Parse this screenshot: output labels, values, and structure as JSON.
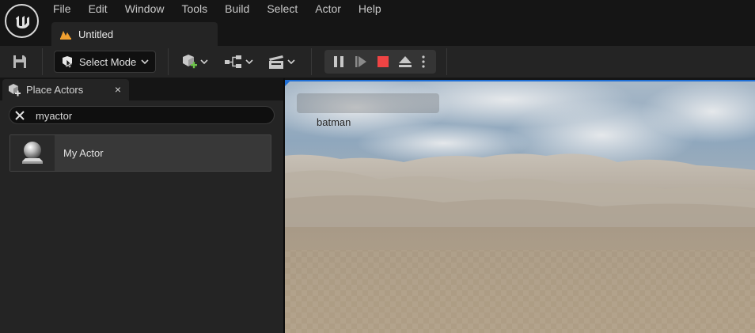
{
  "menu": {
    "items": [
      "File",
      "Edit",
      "Window",
      "Tools",
      "Build",
      "Select",
      "Actor",
      "Help"
    ]
  },
  "document_tab": {
    "title": "Untitled"
  },
  "toolbar": {
    "mode_label": "Select Mode",
    "icons": [
      "save-icon",
      "add-actor-icon",
      "blueprint-icon",
      "cinematics-icon",
      "pause-icon",
      "step-icon",
      "stop-icon",
      "eject-icon",
      "options-icon"
    ]
  },
  "place_actors": {
    "tab_label": "Place Actors",
    "close_glyph": "×",
    "search_value": "myactor",
    "items": [
      {
        "label": "My Actor"
      }
    ]
  },
  "viewport": {
    "overlay_label": "batman"
  },
  "colors": {
    "accent": "#1f6fd6",
    "stop": "#ef4444",
    "add_green": "#6cc24a",
    "tab_orange": "#f0a030"
  }
}
